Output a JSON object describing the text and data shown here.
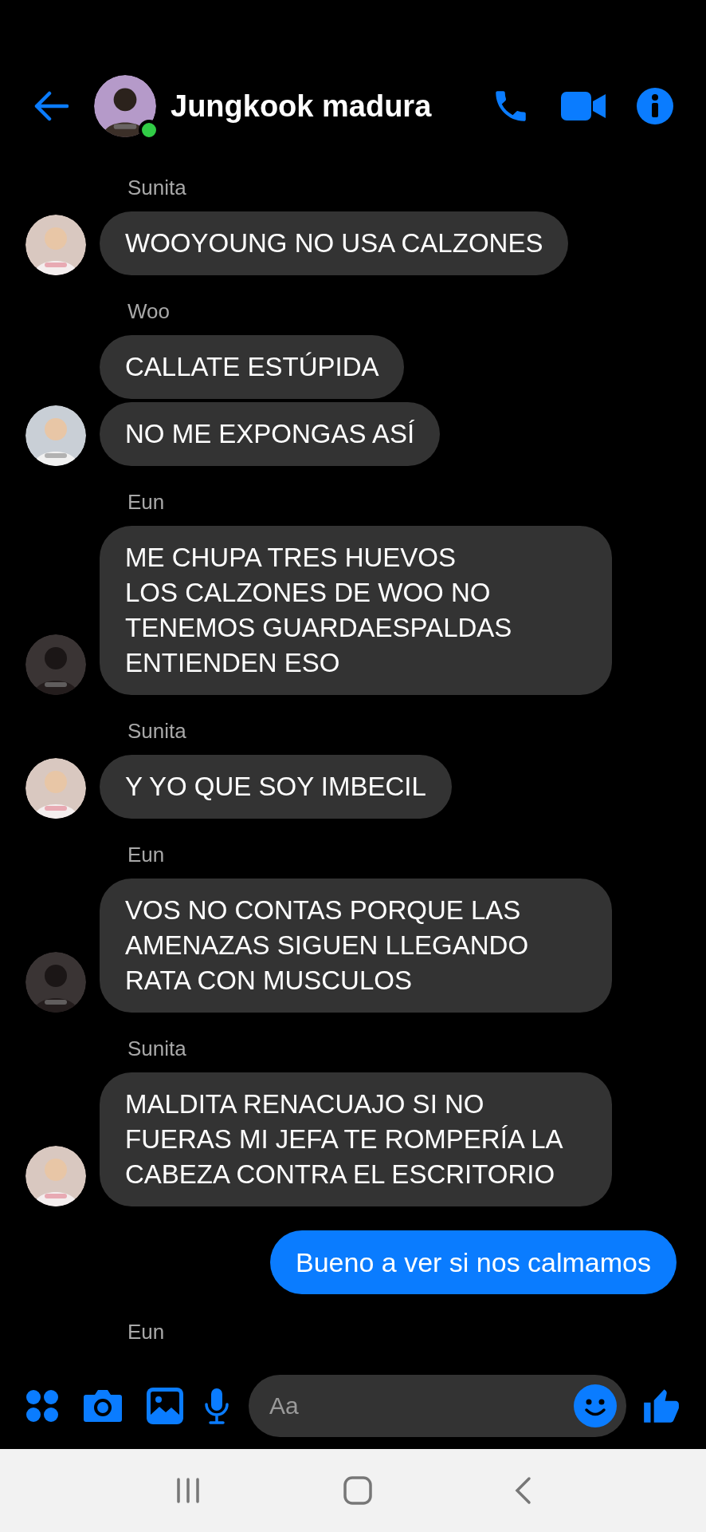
{
  "header": {
    "title": "Jungkook madura",
    "online": true
  },
  "messages": [
    {
      "kind": "incoming",
      "sender": "Sunita",
      "bubbles": [
        "WOOYOUNG NO USA CALZONES"
      ]
    },
    {
      "kind": "incoming",
      "sender": "Woo",
      "bubbles": [
        "CALLATE ESTÚPIDA",
        "NO ME EXPONGAS ASÍ"
      ]
    },
    {
      "kind": "incoming",
      "sender": "Eun",
      "bubbles": [
        "ME CHUPA TRES HUEVOS\nLOS CALZONES DE WOO NO TENEMOS GUARDAESPALDAS ENTIENDEN ESO"
      ]
    },
    {
      "kind": "incoming",
      "sender": "Sunita",
      "bubbles": [
        "Y YO QUE SOY IMBECIL"
      ]
    },
    {
      "kind": "incoming",
      "sender": "Eun",
      "bubbles": [
        "VOS NO CONTAS PORQUE LAS AMENAZAS SIGUEN LLEGANDO RATA CON MUSCULOS"
      ]
    },
    {
      "kind": "incoming",
      "sender": "Sunita",
      "bubbles": [
        "MALDITA RENACUAJO SI NO FUERAS MI JEFA TE ROMPERÍA LA CABEZA CONTRA EL ESCRITORIO"
      ]
    },
    {
      "kind": "outgoing",
      "bubbles": [
        "Bueno a ver si nos calmamos"
      ]
    },
    {
      "kind": "typing_label",
      "sender": "Eun"
    }
  ],
  "composer": {
    "placeholder": "Aa"
  }
}
